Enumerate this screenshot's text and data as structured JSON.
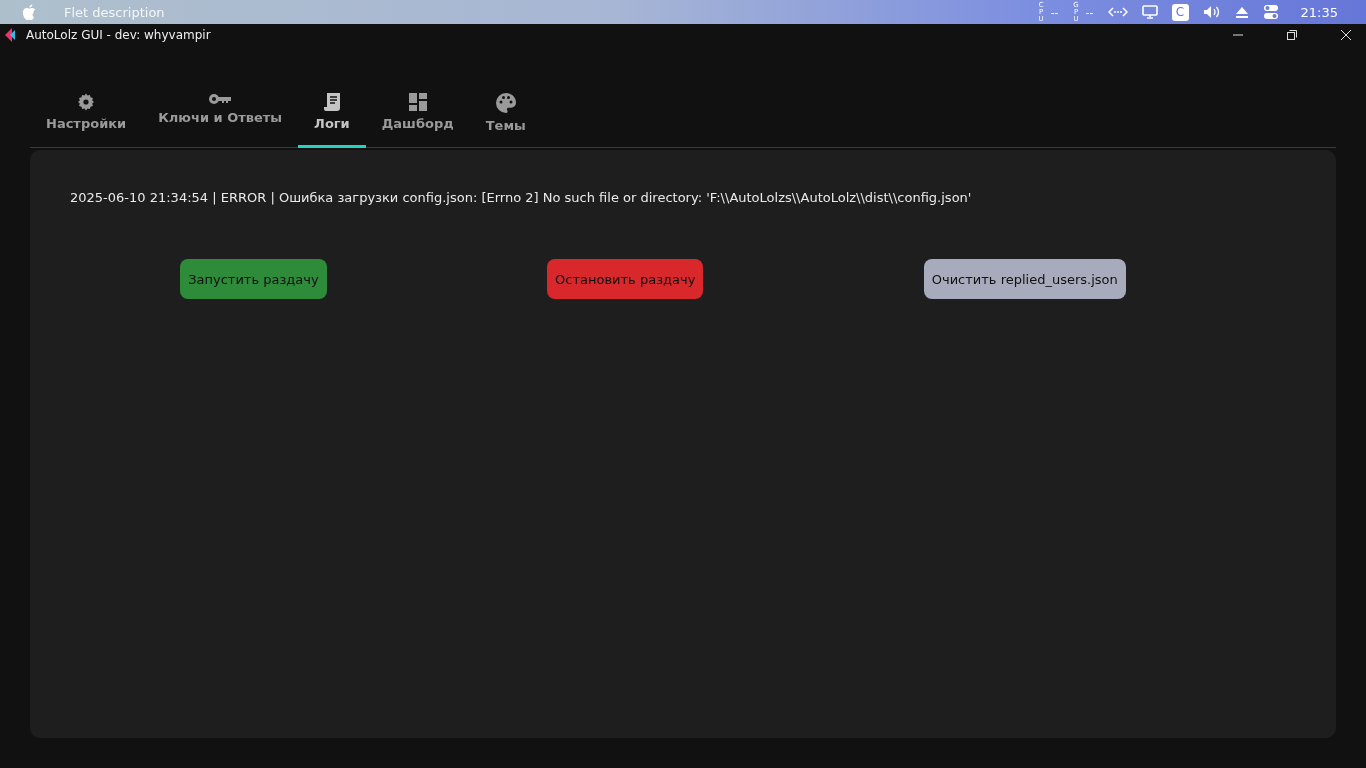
{
  "menu_bar": {
    "app_name": "Flet description",
    "status": [
      {
        "kind": "meter",
        "label": "CPU",
        "value": "--"
      },
      {
        "kind": "meter",
        "label": "GPU",
        "value": "--"
      }
    ],
    "badge": "C",
    "clock": "21:35"
  },
  "window": {
    "title": "AutoLolz GUI - dev: whyvampir"
  },
  "tabs": [
    {
      "label": "Настройки",
      "selected": false
    },
    {
      "label": "Ключи и Ответы",
      "selected": false
    },
    {
      "label": "Логи",
      "selected": true
    },
    {
      "label": "Дашборд",
      "selected": false
    },
    {
      "label": "Темы",
      "selected": false
    }
  ],
  "log_lines": [
    "2025-06-10 21:34:54 | ERROR | Ошибка загрузки config.json: [Errno 2] No such file or directory: 'F:\\\\AutoLolzs\\\\AutoLolz\\\\dist\\\\config.json'"
  ],
  "buttons": [
    {
      "label": "Запустить раздачу",
      "color": "#2e8b3a"
    },
    {
      "label": "Остановить раздачу",
      "color": "#d9282b"
    },
    {
      "label": "Очистить replied_users.json",
      "color": "#a7abbb"
    }
  ]
}
